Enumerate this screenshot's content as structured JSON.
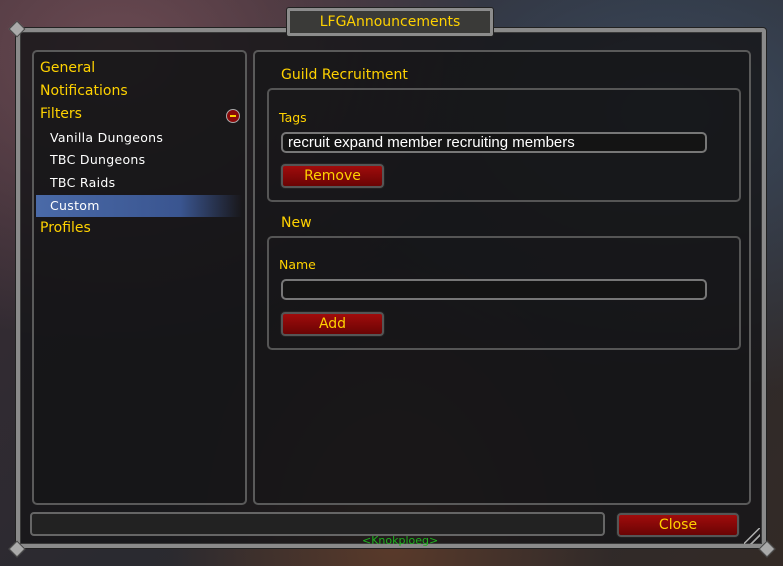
{
  "window": {
    "title": "LFGAnnouncements"
  },
  "sidebar": {
    "items": [
      {
        "label": "General"
      },
      {
        "label": "Notifications"
      },
      {
        "label": "Filters",
        "expanded": true,
        "children": [
          {
            "label": "Vanilla Dungeons"
          },
          {
            "label": "TBC Dungeons"
          },
          {
            "label": "TBC Raids"
          },
          {
            "label": "Custom",
            "selected": true
          }
        ]
      },
      {
        "label": "Profiles"
      }
    ],
    "collapse_icon": "minus-icon"
  },
  "main": {
    "group1": {
      "title": "Guild Recruitment",
      "tags_label": "Tags",
      "tags_value": "recruit expand member recruiting members",
      "remove_label": "Remove"
    },
    "group2": {
      "title": "New",
      "name_label": "Name",
      "name_value": "",
      "add_label": "Add"
    }
  },
  "footer": {
    "status_text": "",
    "close_label": "Close"
  },
  "background": {
    "nameplate": "<Knokploeg>"
  },
  "colors": {
    "gold": "#ffd200",
    "button_red": "#8a0808",
    "selection_blue": "#4a6aa8"
  }
}
